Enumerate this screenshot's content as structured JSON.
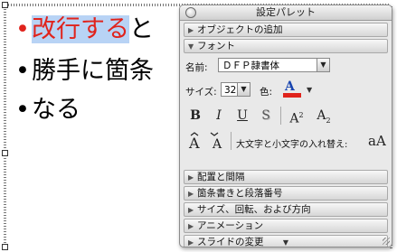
{
  "slide": {
    "lines": [
      {
        "highlighted": "改行する",
        "rest": "と"
      },
      {
        "text": "勝手に箇条"
      },
      {
        "text": "なる"
      }
    ],
    "bullet": "•"
  },
  "palette": {
    "title": "設定パレット",
    "sections_top": [
      "オブジェクトの追加",
      "フォント"
    ],
    "font_label": "名前:",
    "font_value": "ＤＦＰ隷書体",
    "size_label": "サイズ:",
    "size_value": "32",
    "color_label": "色:",
    "bold": "B",
    "italic": "I",
    "underline": "U",
    "shadow": "S",
    "superscript": "A",
    "superscript_mark": "2",
    "subscript": "A",
    "subscript_mark": "2",
    "case_label": "大文字と小文字の入れ替え:",
    "case_aa": "aA",
    "sections_bottom": [
      "配置と間隔",
      "箇条書きと段落番号",
      "サイズ、回転、および方向",
      "アニメーション",
      "スライドの変更"
    ]
  },
  "colors": {
    "accent_text": "#e0231c",
    "highlight": "#b8d3f5"
  }
}
